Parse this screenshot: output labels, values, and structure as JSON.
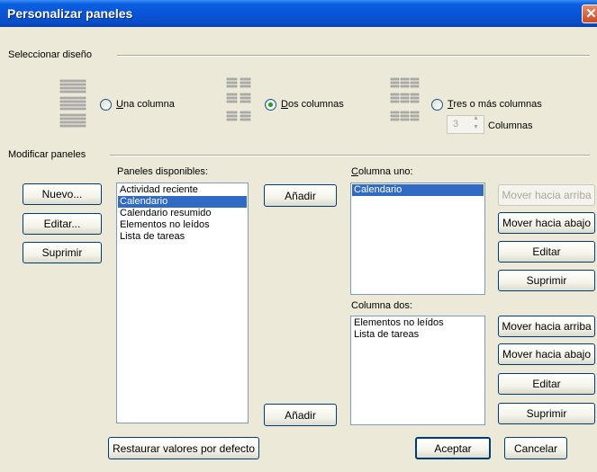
{
  "window": {
    "title": "Personalizar paneles",
    "close_glyph": "✕"
  },
  "design": {
    "heading": "Seleccionar diseño",
    "options": [
      {
        "label": "Una columna",
        "mnemonic": "U",
        "rest": "na columna",
        "selected": false
      },
      {
        "label": "Dos columnas",
        "mnemonic": "D",
        "rest": "os columnas",
        "selected": true
      },
      {
        "label": "Tres o más columnas",
        "mnemonic": "T",
        "rest": "res o más columnas",
        "selected": false
      }
    ],
    "columns_value": "3",
    "columns_label": "Columnas"
  },
  "modify": {
    "heading": "Modificar paneles",
    "left_buttons": {
      "new": "Nuevo...",
      "edit": "Editar...",
      "delete": "Suprimir"
    },
    "available": {
      "label": "Paneles disponibles:",
      "items": [
        "Actividad reciente",
        "Calendario",
        "Calendario resumido",
        "Elementos no leídos",
        "Lista de tareas"
      ],
      "selected_index": 1
    },
    "add_top": "Añadir",
    "add_bottom": "Añadir",
    "column_one": {
      "label": "Columna uno:",
      "mnemonic": "C",
      "rest": "olumna uno:",
      "items": [
        "Calendario"
      ],
      "selected_index": 0,
      "buttons": {
        "up": "Mover hacia arriba",
        "down": "Mover hacia abajo",
        "edit": "Editar",
        "delete": "Suprimir"
      }
    },
    "column_two": {
      "label": "Columna dos:",
      "items": [
        "Elementos no leídos",
        "Lista de tareas"
      ],
      "buttons": {
        "up": "Mover hacia arriba",
        "down": "Mover hacia abajo",
        "edit": "Editar",
        "delete": "Suprimir"
      }
    }
  },
  "footer": {
    "restore": "Restaurar valores por defecto",
    "ok": "Aceptar",
    "cancel": "Cancelar"
  },
  "colors": {
    "titlebar": "#0a55d8",
    "selection": "#316ac5",
    "dialog_bg": "#ece9d8",
    "radio_dot": "#21a121"
  }
}
